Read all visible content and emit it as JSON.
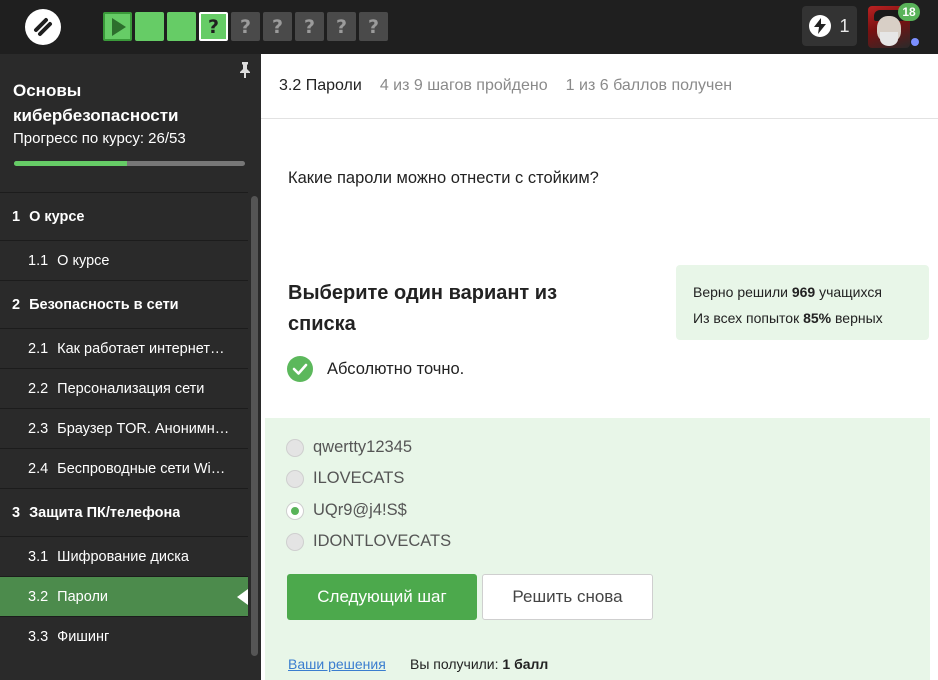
{
  "topbar": {
    "steps": [
      {
        "type": "video"
      },
      {
        "type": "passed"
      },
      {
        "type": "passed"
      },
      {
        "type": "current",
        "label": "?"
      },
      {
        "type": "locked",
        "label": "?"
      },
      {
        "type": "locked",
        "label": "?"
      },
      {
        "type": "locked",
        "label": "?"
      },
      {
        "type": "locked",
        "label": "?"
      },
      {
        "type": "locked",
        "label": "?"
      }
    ],
    "energy_count": "1",
    "notifications_badge": "18"
  },
  "sidebar": {
    "course_title": "Основы кибербезопасности",
    "progress_label": "Прогресс по курсу:  26/53",
    "progress_fraction": 0.49,
    "toc": [
      {
        "kind": "section",
        "num": "1",
        "label": "О курсе"
      },
      {
        "kind": "lesson",
        "num": "1.1",
        "label": "О курсе"
      },
      {
        "kind": "section",
        "num": "2",
        "label": "Безопасность в сети"
      },
      {
        "kind": "lesson",
        "num": "2.1",
        "label": "Как работает интернет…"
      },
      {
        "kind": "lesson",
        "num": "2.2",
        "label": "Персонализация сети"
      },
      {
        "kind": "lesson",
        "num": "2.3",
        "label": "Браузер TOR. Анонимн…"
      },
      {
        "kind": "lesson",
        "num": "2.4",
        "label": "Беспроводные сети Wi…"
      },
      {
        "kind": "section",
        "num": "3",
        "label": "Защита ПК/телефона"
      },
      {
        "kind": "lesson",
        "num": "3.1",
        "label": "Шифрование диска"
      },
      {
        "kind": "lesson",
        "num": "3.2",
        "label": "Пароли",
        "active": true
      },
      {
        "kind": "lesson",
        "num": "3.3",
        "label": "Фишинг"
      }
    ]
  },
  "lesson_bar": {
    "name": "3.2 Пароли",
    "steps_progress": "4 из 9 шагов пройдено",
    "points": "1 из 6 баллов  получен"
  },
  "question": "Какие пароли можно отнести с стойким?",
  "stats": {
    "solved_prefix": "Верно решили ",
    "solved_count": "969",
    "solved_suffix": " учащихся",
    "attempts_prefix": "Из всех попыток ",
    "attempts_pct": "85%",
    "attempts_suffix": " верных"
  },
  "choose_title": "Выберите один вариант из списка",
  "verdict": "Абсолютно точно.",
  "options": [
    {
      "label": "qwertty12345",
      "checked": false
    },
    {
      "label": "ILOVECATS",
      "checked": false
    },
    {
      "label": "UQr9@j4!S$",
      "checked": true
    },
    {
      "label": "IDONTLOVECATS",
      "checked": false
    }
  ],
  "buttons": {
    "next": "Следующий шаг",
    "retry": "Решить снова"
  },
  "footer": {
    "solutions_link": "Ваши решения",
    "got_prefix": "Вы получили: ",
    "got_value": "1 балл"
  }
}
